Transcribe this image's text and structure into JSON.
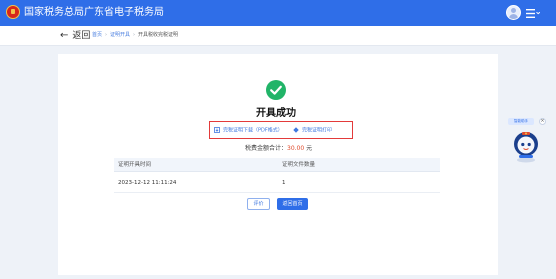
{
  "header": {
    "site_title": "国家税务总局广东省电子税务局",
    "brand_color": "#2f6ee8",
    "emblem_icon": "national-emblem-icon",
    "avatar_icon": "user-avatar-icon",
    "menu_icon": "menu-icon"
  },
  "nav": {
    "back_label": "返回",
    "breadcrumb": [
      "首页",
      "证明开具",
      "开具税收完税证明"
    ]
  },
  "result": {
    "title": "开具成功",
    "status_icon": "success-check-icon",
    "success_color": "#21b468",
    "download_label": "完税证明下载（PDF格式）",
    "print_label": "完税证明打印",
    "amount_label": "税费金额合计：",
    "amount_value": "30.00",
    "amount_unit": "元"
  },
  "table": {
    "headers": [
      "证明开具时间",
      "证明文件数量"
    ],
    "rows": [
      [
        "2023-12-12 11:11:24",
        "1"
      ]
    ]
  },
  "buttons": {
    "review_label": "评价",
    "home_label": "返回首页"
  },
  "assistant": {
    "tag_label": "智能助手",
    "close_label": "×",
    "robot_icon": "assistant-robot-icon"
  },
  "highlight_color": "#e33a3a"
}
